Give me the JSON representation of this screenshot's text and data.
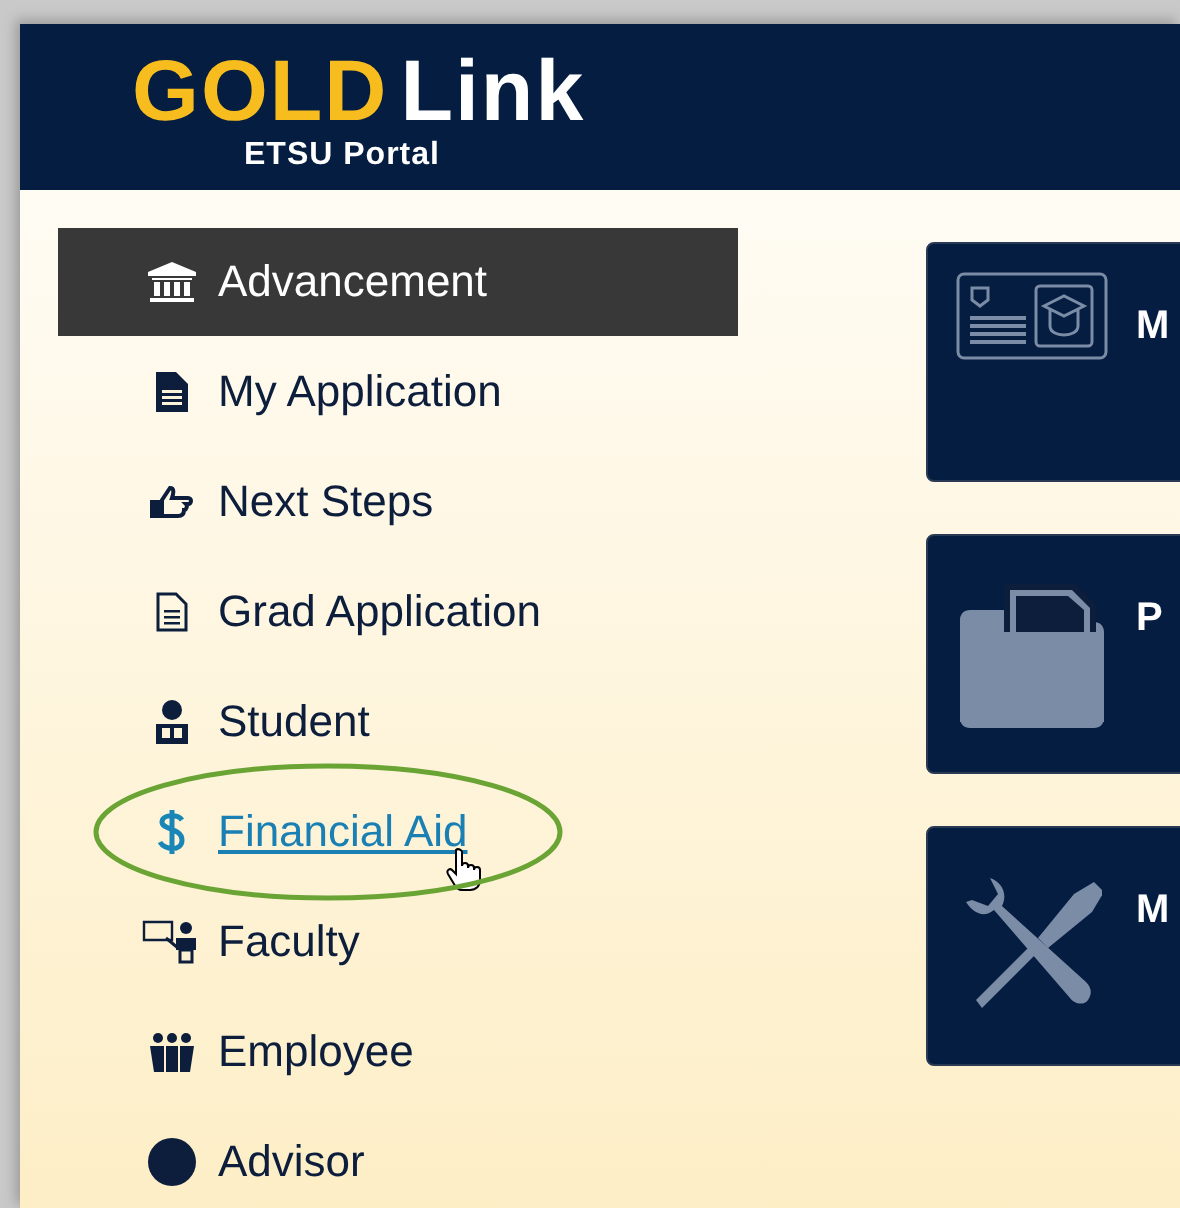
{
  "header": {
    "logo": [
      {
        "text": "GOLD",
        "color": "#f7bd1e"
      },
      {
        "text": "Link",
        "color": "#ffffff"
      }
    ],
    "subtitle": "ETSU Portal"
  },
  "sidebar": {
    "items": [
      {
        "label": "Advancement",
        "kind": "bank",
        "selected": true,
        "hovered": false,
        "circled": false
      },
      {
        "label": "My Application",
        "kind": "document",
        "selected": false,
        "hovered": false,
        "circled": false
      },
      {
        "label": "Next Steps",
        "kind": "thumb",
        "selected": false,
        "hovered": false,
        "circled": false
      },
      {
        "label": "Grad Application",
        "kind": "outline",
        "selected": false,
        "hovered": false,
        "circled": false
      },
      {
        "label": "Student",
        "kind": "reader",
        "selected": false,
        "hovered": false,
        "circled": false
      },
      {
        "label": "Financial Aid",
        "kind": "dollar",
        "selected": false,
        "hovered": true,
        "circled": true
      },
      {
        "label": "Faculty",
        "kind": "teacher",
        "selected": false,
        "hovered": false,
        "circled": false
      },
      {
        "label": "Employee",
        "kind": "group",
        "selected": false,
        "hovered": false,
        "circled": false
      },
      {
        "label": "Advisor",
        "kind": "advisor",
        "selected": false,
        "hovered": false,
        "circled": false
      }
    ]
  },
  "cards": [
    {
      "title": "M",
      "kind": "card"
    },
    {
      "title": "P",
      "kind": "folder"
    },
    {
      "title": "M",
      "kind": "tools"
    }
  ]
}
